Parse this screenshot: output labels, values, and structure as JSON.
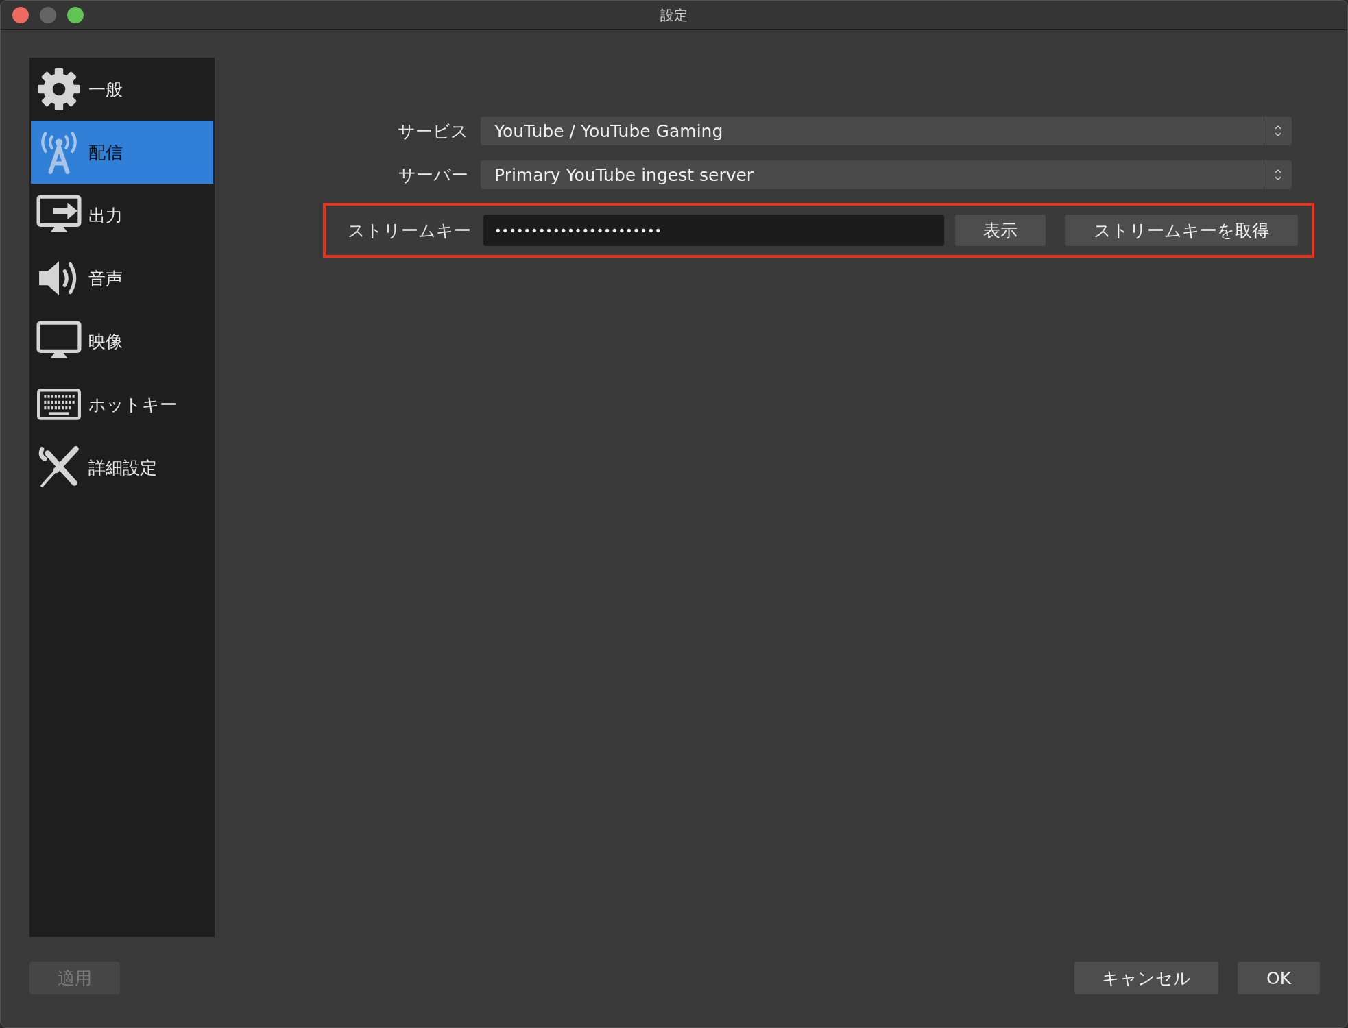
{
  "window": {
    "title": "設定"
  },
  "sidebar": {
    "items": [
      {
        "label": "一般",
        "kind": "gear",
        "selected": false
      },
      {
        "label": "配信",
        "kind": "antenna",
        "selected": true
      },
      {
        "label": "出力",
        "kind": "output",
        "selected": false
      },
      {
        "label": "音声",
        "kind": "speaker",
        "selected": false
      },
      {
        "label": "映像",
        "kind": "monitor",
        "selected": false
      },
      {
        "label": "ホットキー",
        "kind": "keyboard",
        "selected": false
      },
      {
        "label": "詳細設定",
        "kind": "tools",
        "selected": false
      }
    ]
  },
  "form": {
    "rows": [
      {
        "label": "サービス",
        "value": "YouTube / YouTube Gaming"
      },
      {
        "label": "サーバー",
        "value": "Primary YouTube ingest server"
      }
    ],
    "stream_key": {
      "label": "ストリームキー",
      "value": "•••••••••••••••••••••••",
      "highlighted": true,
      "buttons": [
        "表示",
        "ストリームキーを取得"
      ]
    }
  },
  "footer": {
    "apply": {
      "label": "適用",
      "disabled": true
    },
    "buttons": [
      "キャンセル",
      "OK"
    ]
  }
}
